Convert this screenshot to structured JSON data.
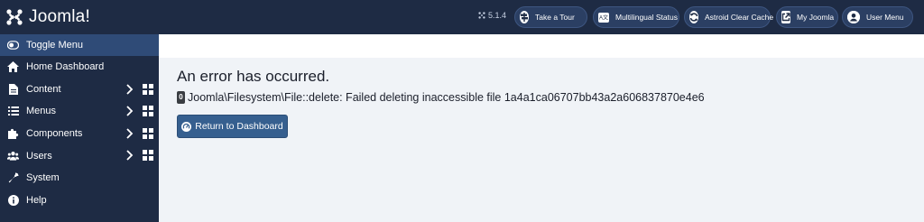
{
  "brand": {
    "name": "Joomla!",
    "icon": "joomla-logo"
  },
  "sidebar": {
    "items": [
      {
        "label": "Toggle Menu",
        "icon": "toggle-icon"
      },
      {
        "label": "Home Dashboard",
        "icon": "home-icon"
      },
      {
        "label": "Content",
        "icon": "file-icon"
      },
      {
        "label": "Menus",
        "icon": "list-icon"
      },
      {
        "label": "Components",
        "icon": "puzzle-icon"
      },
      {
        "label": "Users",
        "icon": "users-icon"
      },
      {
        "label": "System",
        "icon": "wrench-icon"
      },
      {
        "label": "Help",
        "icon": "info-icon"
      }
    ]
  },
  "header": {
    "version": "5.1.4",
    "buttons": {
      "tour": "Take a Tour",
      "multilingual": "Multilingual Status",
      "cache": "Astroid Clear Cache",
      "my_joomla": "My Joomla",
      "user_menu": "User Menu"
    }
  },
  "main": {
    "title": "An error has occurred.",
    "error_code": "0",
    "error_message": "Joomla\\Filesystem\\File::delete: Failed deleting inaccessible file 1a4a1ca06707bb43a2a606837870e4e6",
    "return_label": "Return to Dashboard"
  },
  "colors": {
    "sidebar_bg": "#1e2b44",
    "accent": "#365f8f",
    "toggle_bg": "#2f4b77"
  }
}
